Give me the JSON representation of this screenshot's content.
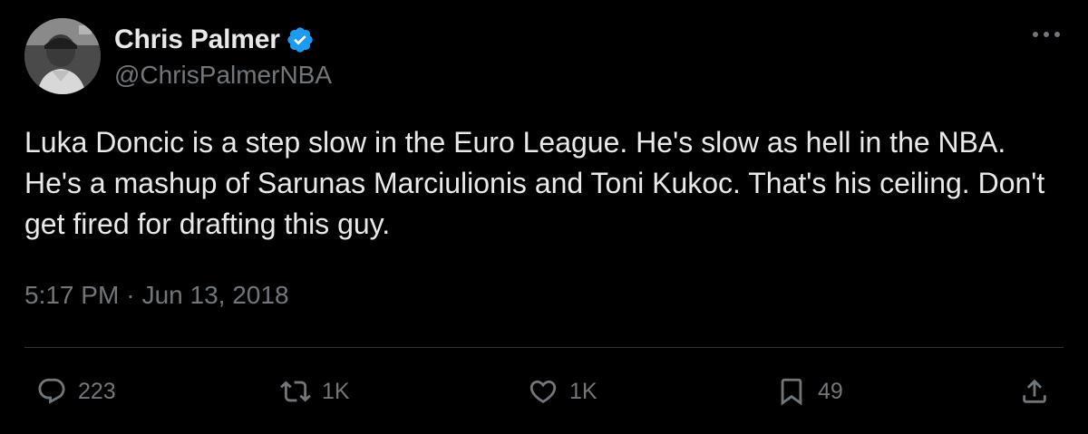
{
  "author": {
    "display_name": "Chris Palmer",
    "handle": "@ChrisPalmerNBA",
    "verified": true
  },
  "tweet": {
    "text": "Luka Doncic is a step slow in the Euro League. He's slow as hell in the NBA. He's a mashup of Sarunas Marciulionis and Toni Kukoc. That's his ceiling. Don't get fired for drafting this guy.",
    "time": "5:17 PM",
    "separator": "·",
    "date": "Jun 13, 2018"
  },
  "actions": {
    "replies": "223",
    "retweets": "1K",
    "likes": "1K",
    "bookmarks": "49"
  },
  "icons": {
    "more": "more-horizontal-icon",
    "verified": "verified-badge-icon",
    "reply": "reply-icon",
    "retweet": "retweet-icon",
    "like": "heart-icon",
    "bookmark": "bookmark-icon",
    "share": "share-icon"
  },
  "colors": {
    "background": "#000000",
    "primary_text": "#e7e9ea",
    "secondary_text": "#71767b",
    "verified_blue": "#1d9bf0",
    "divider": "#2f3336"
  }
}
